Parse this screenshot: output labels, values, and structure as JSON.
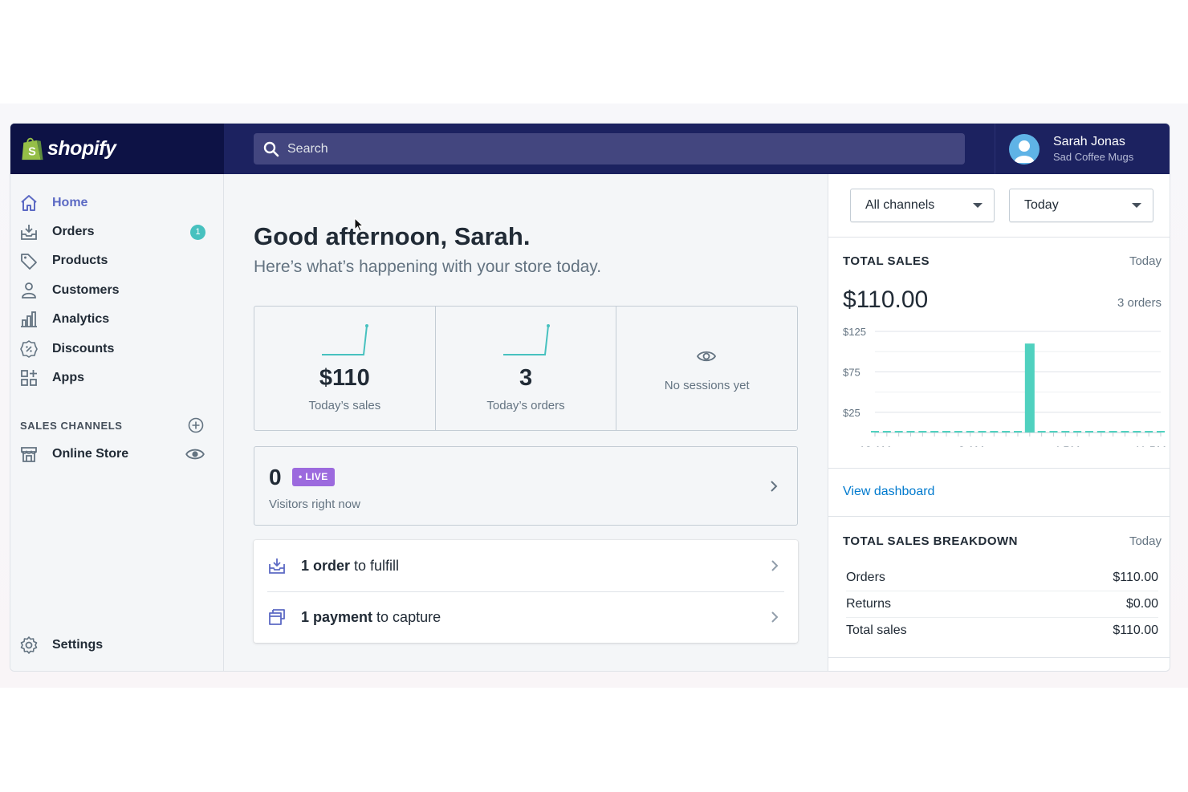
{
  "brand": {
    "logo_text": "shopify",
    "logo_color": "#95bf47"
  },
  "search": {
    "placeholder": "Search"
  },
  "user": {
    "name": "Sarah Jonas",
    "store": "Sad Coffee Mugs"
  },
  "sidebar": {
    "items": [
      {
        "label": "Home",
        "icon": "home-icon",
        "active": true
      },
      {
        "label": "Orders",
        "icon": "orders-icon",
        "badge": "1"
      },
      {
        "label": "Products",
        "icon": "tag-icon"
      },
      {
        "label": "Customers",
        "icon": "person-icon"
      },
      {
        "label": "Analytics",
        "icon": "bar-chart-icon"
      },
      {
        "label": "Discounts",
        "icon": "discount-icon"
      },
      {
        "label": "Apps",
        "icon": "apps-icon"
      }
    ],
    "sales_channels_label": "SALES CHANNELS",
    "channels": [
      {
        "label": "Online Store",
        "icon": "store-icon"
      }
    ],
    "settings_label": "Settings"
  },
  "main": {
    "greeting": "Good afternoon, Sarah.",
    "subgreeting": "Here’s what’s happening with your store today.",
    "stats": [
      {
        "value": "$110",
        "label": "Today’s sales"
      },
      {
        "value": "3",
        "label": "Today’s orders"
      },
      {
        "label": "No sessions yet"
      }
    ],
    "live": {
      "count": "0",
      "badge": "LIVE",
      "label": "Visitors right now"
    },
    "tasks": [
      {
        "bold": "1 order",
        "rest": " to fulfill"
      },
      {
        "bold": "1 payment",
        "rest": " to capture"
      }
    ]
  },
  "right": {
    "channel_select": "All channels",
    "period_select": "Today",
    "total_sales": {
      "title": "TOTAL SALES",
      "period": "Today",
      "value": "$110.00",
      "orders": "3 orders"
    },
    "view_dashboard": "View dashboard",
    "breakdown": {
      "title": "TOTAL SALES BREAKDOWN",
      "period": "Today",
      "rows": [
        {
          "label": "Orders",
          "value": "$110.00"
        },
        {
          "label": "Returns",
          "value": "$0.00"
        },
        {
          "label": "Total sales",
          "value": "$110.00"
        }
      ]
    }
  },
  "chart_data": {
    "type": "bar",
    "x_labels": [
      "12 AM",
      "8 AM",
      "4 PM",
      "11 PM"
    ],
    "y_ticks": [
      "$125",
      "$75",
      "$25"
    ],
    "ylim": [
      0,
      125
    ],
    "hours": [
      0,
      1,
      2,
      3,
      4,
      5,
      6,
      7,
      8,
      9,
      10,
      11,
      12,
      13,
      14,
      15,
      15,
      16,
      17,
      18,
      19,
      20,
      21,
      22,
      23
    ],
    "values": [
      0,
      0,
      0,
      0,
      0,
      0,
      0,
      0,
      0,
      0,
      0,
      0,
      0,
      110,
      0,
      0,
      0,
      0,
      0,
      0,
      0,
      0,
      0,
      0,
      0
    ],
    "bar_color": "#50d1bf"
  }
}
